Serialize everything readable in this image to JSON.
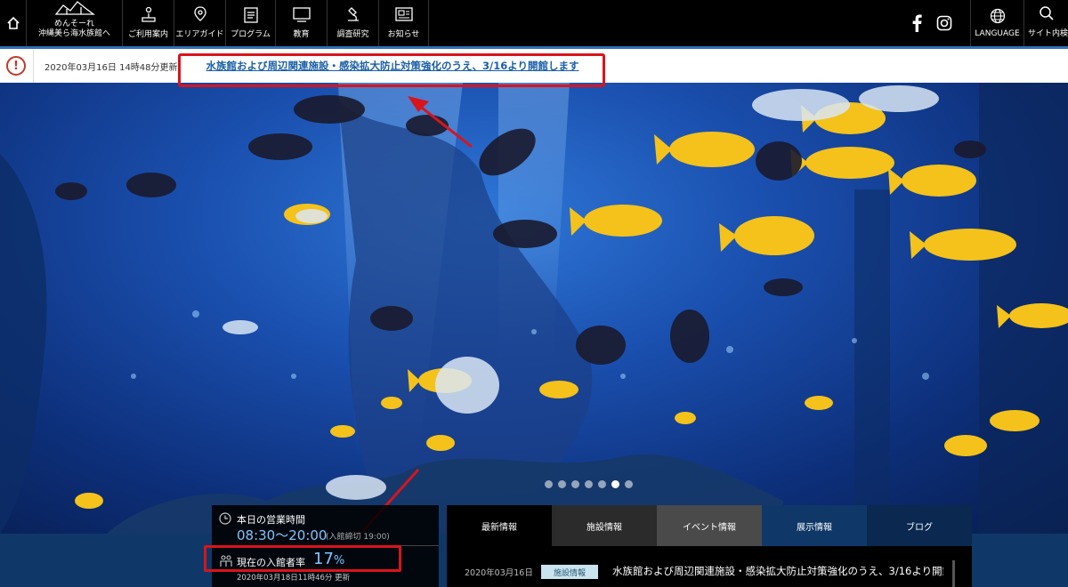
{
  "nav": {
    "items": [
      {
        "label_line1": "めんそーれ",
        "label_line2": "沖縄美ら海水族館へ"
      },
      {
        "label": "ご利用案内"
      },
      {
        "label": "エリアガイド"
      },
      {
        "label": "プログラム"
      },
      {
        "label": "教育"
      },
      {
        "label": "調査研究"
      },
      {
        "label": "お知らせ"
      }
    ],
    "language_label": "LANGUAGE",
    "search_label": "サイト内検索"
  },
  "notice": {
    "date": "2020年03月16日 14時48分更新",
    "link_text": "水族館および周辺関連施設・感染拡大防止対策強化のうえ、3/16より開館します"
  },
  "carousel": {
    "dot_count": 7,
    "active_index": 5
  },
  "hours": {
    "label": "本日の営業時間",
    "time": "08:30〜20:00",
    "note": "(入館締切 19:00)"
  },
  "visitors": {
    "label": "現在の入館者率",
    "rate": "17",
    "unit": "%",
    "updated": "2020年03月18日11時46分 更新"
  },
  "news": {
    "tabs": [
      "最新情報",
      "施設情報",
      "イベント情報",
      "展示情報",
      "ブログ"
    ],
    "items": [
      {
        "date": "2020年03月16日",
        "category": "施設情報",
        "title": "水族館および周辺関連施設・感染拡大防止対策強化のうえ、3/16より開館しま"
      }
    ]
  },
  "colors": {
    "accent_blue": "#2f6fb7",
    "highlight_red": "#d9141c",
    "link_blue": "#1a5fa8"
  }
}
